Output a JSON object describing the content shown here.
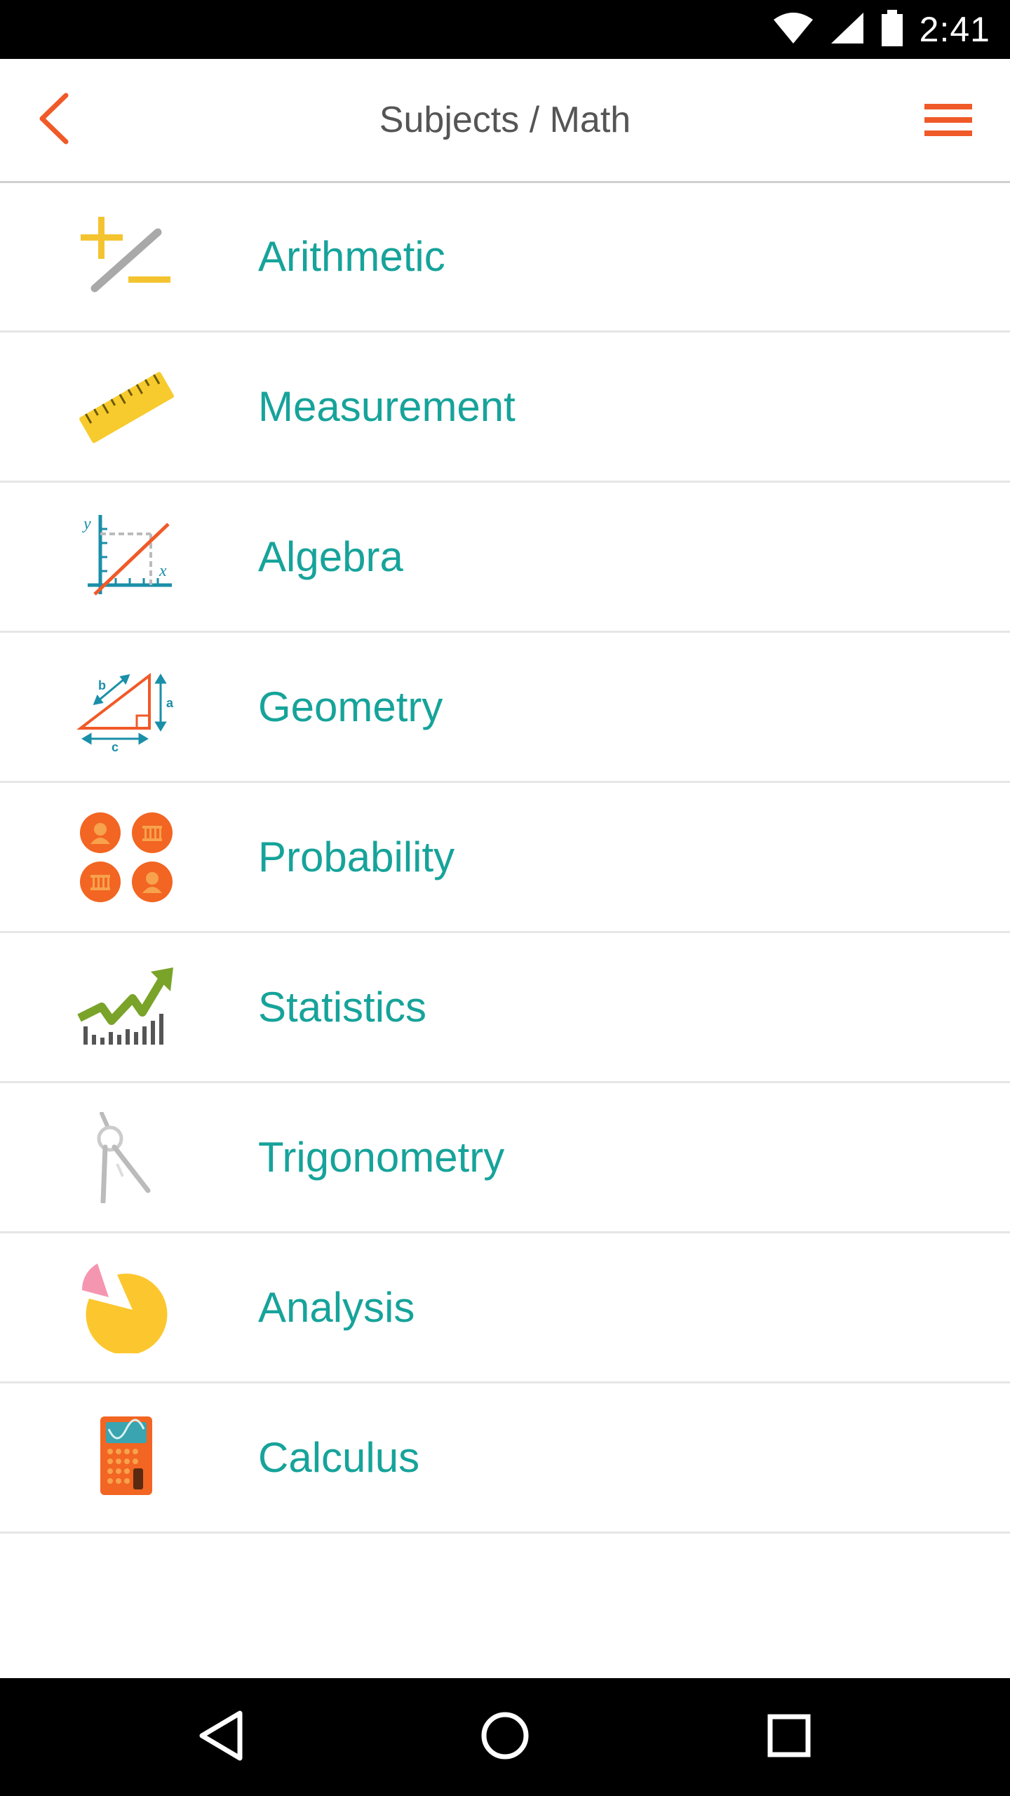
{
  "status_bar": {
    "time": "2:41"
  },
  "header": {
    "title": "Subjects / Math",
    "accent_color": "#f05a28"
  },
  "subjects": [
    {
      "label": "Arithmetic",
      "icon": "plus-minus-icon"
    },
    {
      "label": "Measurement",
      "icon": "ruler-icon"
    },
    {
      "label": "Algebra",
      "icon": "graph-axes-icon"
    },
    {
      "label": "Geometry",
      "icon": "triangle-icon"
    },
    {
      "label": "Probability",
      "icon": "coins-icon"
    },
    {
      "label": "Statistics",
      "icon": "trend-chart-icon"
    },
    {
      "label": "Trigonometry",
      "icon": "compass-icon"
    },
    {
      "label": "Analysis",
      "icon": "pie-chart-icon"
    },
    {
      "label": "Calculus",
      "icon": "calculator-icon"
    }
  ],
  "colors": {
    "label": "#16a39a",
    "divider": "#e6e6e6"
  }
}
